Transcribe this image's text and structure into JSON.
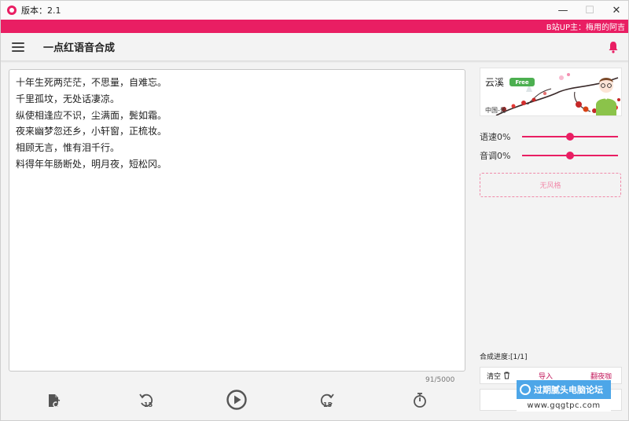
{
  "window": {
    "title": "版本：2.1",
    "controls": {
      "minimize": "—",
      "maximize": "☐",
      "close": "✕"
    }
  },
  "banner": {
    "text": "B站UP主：梅用的阿吉"
  },
  "appbar": {
    "title": "一点红语音合成",
    "menu_icon": "hamburger-menu-icon",
    "notify_icon": "bell-icon"
  },
  "editor": {
    "lines": [
      "十年生死两茫茫，不思量，自难忘。",
      "千里孤坟，无处话凄凉。",
      "纵使相逢应不识，尘满面，鬓如霜。",
      "夜来幽梦忽还乡，小轩窗，正梳妆。",
      "相顾无言，惟有泪千行。",
      "料得年年肠断处，明月夜，短松冈。"
    ],
    "char_count": "91/5000"
  },
  "toolbar": {
    "icons": [
      "music-file-icon",
      "rewind-15-icon",
      "play-icon",
      "forward-15-icon",
      "timer-icon"
    ],
    "rewind_label": "15",
    "forward_label": "15"
  },
  "voice": {
    "name": "云溪",
    "badge": "Free",
    "region": "中国-普"
  },
  "sliders": [
    {
      "label": "语速0%",
      "value": 0.5
    },
    {
      "label": "音调0%",
      "value": 0.5
    }
  ],
  "style": {
    "label": "无风格"
  },
  "progress": {
    "label": "合成进度:[1/1]"
  },
  "actions": {
    "clear_label": "清空",
    "import_label": "导入",
    "export_label": "翻夜咖"
  },
  "watermark": {
    "name": "过期腻头电脑论坛",
    "url": "www.gqgtpc.com"
  },
  "colors": {
    "accent": "#e91e63",
    "badge_green": "#4caf50",
    "watermark_blue": "#4da6e8"
  }
}
